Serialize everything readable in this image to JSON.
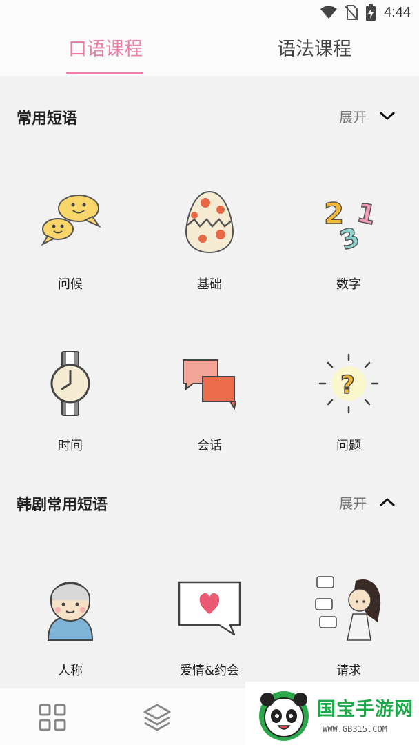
{
  "status_bar": {
    "time": "4:44",
    "icons": [
      "wifi-icon",
      "no-sim-icon",
      "battery-charging-icon"
    ]
  },
  "tabs": [
    {
      "label": "口语课程",
      "active": true
    },
    {
      "label": "语法课程",
      "active": false
    }
  ],
  "sections": [
    {
      "title": "常用短语",
      "expand_label": "展开",
      "chevron": "chevron-down-icon",
      "items": [
        {
          "label": "问候",
          "icon": "chat-smiles-icon"
        },
        {
          "label": "基础",
          "icon": "cracked-egg-icon"
        },
        {
          "label": "数字",
          "icon": "numbers-icon"
        },
        {
          "label": "时间",
          "icon": "wristwatch-icon"
        },
        {
          "label": "会话",
          "icon": "speech-bubbles-icon"
        },
        {
          "label": "问题",
          "icon": "question-mark-icon"
        }
      ]
    },
    {
      "title": "韩剧常用短语",
      "expand_label": "展开",
      "chevron": "chevron-up-icon",
      "items": [
        {
          "label": "人称",
          "icon": "person-hoodie-icon"
        },
        {
          "label": "爱情&约会",
          "icon": "heart-bubble-icon"
        },
        {
          "label": "请求",
          "icon": "girl-with-bubbles-icon"
        }
      ]
    }
  ],
  "bottom_nav": [
    {
      "icon": "grid-icon"
    },
    {
      "icon": "layers-icon"
    }
  ],
  "watermark": {
    "text": "国宝手游网",
    "url": "WWW.GB315.COM"
  },
  "colors": {
    "accent": "#ec7fa7",
    "background": "#f3f2f2",
    "surface": "#fbfbfb"
  }
}
